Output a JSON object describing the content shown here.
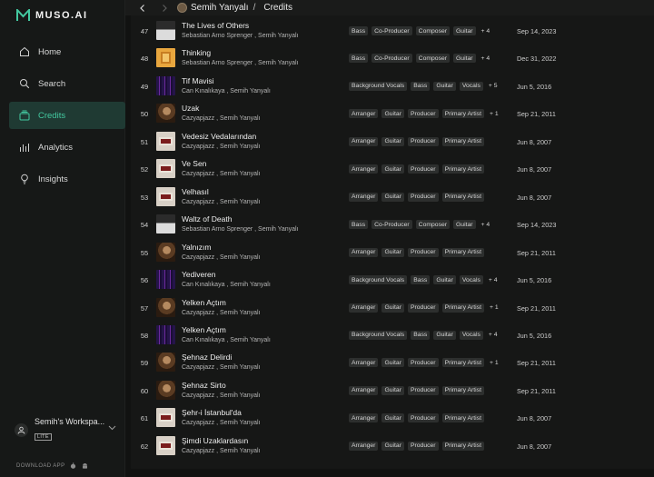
{
  "app": {
    "name": "MUSO.AI"
  },
  "nav": [
    {
      "label": "Home",
      "icon": "home-icon",
      "active": false
    },
    {
      "label": "Search",
      "icon": "search-icon",
      "active": false
    },
    {
      "label": "Credits",
      "icon": "credits-icon",
      "active": true
    },
    {
      "label": "Analytics",
      "icon": "analytics-icon",
      "active": false
    },
    {
      "label": "Insights",
      "icon": "lightbulb-icon",
      "active": false
    }
  ],
  "workspace": {
    "name": "Semih's Workspa...",
    "badge": "LITE"
  },
  "download": {
    "label": "DOWNLOAD APP"
  },
  "breadcrumb": {
    "artist": "Semih Yanyalı",
    "separator": "/",
    "page": "Credits"
  },
  "colors": {
    "accent": "#43c9a0",
    "active_bg": "#1f3a33",
    "tag_bg": "#2d2f2e"
  },
  "rows": [
    {
      "num": "47",
      "title": "The Lives of Others",
      "artists": "Sebastian Arno Sprenger , Semih Yanyalı",
      "tags": [
        "Bass",
        "Co-Producer",
        "Composer",
        "Guitar"
      ],
      "more": "+ 4",
      "date": "Sep 14, 2023",
      "art": "art-lives"
    },
    {
      "num": "48",
      "title": "Thinking",
      "artists": "Sebastian Arno Sprenger , Semih Yanyalı",
      "tags": [
        "Bass",
        "Co-Producer",
        "Composer",
        "Guitar"
      ],
      "more": "+ 4",
      "date": "Dec 31, 2022",
      "art": "art-thinking"
    },
    {
      "num": "49",
      "title": "Tif Mavisi",
      "artists": "Can Kınalıkaya , Semih Yanyalı",
      "tags": [
        "Background Vocals",
        "Bass",
        "Guitar",
        "Vocals"
      ],
      "more": "+ 5",
      "date": "Jun 5, 2016",
      "art": "art-tif"
    },
    {
      "num": "50",
      "title": "Uzak",
      "artists": "Cazyapjazz , Semih Yanyalı",
      "tags": [
        "Arranger",
        "Guitar",
        "Producer",
        "Primary Artist"
      ],
      "more": "+ 1",
      "date": "Sep 21, 2011",
      "art": "art-uzak"
    },
    {
      "num": "51",
      "title": "Vedesiz Vedalarından",
      "artists": "Cazyapjazz , Semih Yanyalı",
      "tags": [
        "Arranger",
        "Guitar",
        "Producer",
        "Primary Artist"
      ],
      "more": "",
      "date": "Jun 8, 2007",
      "art": "art-vedal"
    },
    {
      "num": "52",
      "title": "Ve Sen",
      "artists": "Cazyapjazz , Semih Yanyalı",
      "tags": [
        "Arranger",
        "Guitar",
        "Producer",
        "Primary Artist"
      ],
      "more": "",
      "date": "Jun 8, 2007",
      "art": "art-vedal"
    },
    {
      "num": "53",
      "title": "Velhasıl",
      "artists": "Cazyapjazz , Semih Yanyalı",
      "tags": [
        "Arranger",
        "Guitar",
        "Producer",
        "Primary Artist"
      ],
      "more": "",
      "date": "Jun 8, 2007",
      "art": "art-vedal"
    },
    {
      "num": "54",
      "title": "Waltz of Death",
      "artists": "Sebastian Arno Sprenger , Semih Yanyalı",
      "tags": [
        "Bass",
        "Co-Producer",
        "Composer",
        "Guitar"
      ],
      "more": "+ 4",
      "date": "Sep 14, 2023",
      "art": "art-lives"
    },
    {
      "num": "55",
      "title": "Yalnızım",
      "artists": "Cazyapjazz , Semih Yanyalı",
      "tags": [
        "Arranger",
        "Guitar",
        "Producer",
        "Primary Artist"
      ],
      "more": "",
      "date": "Sep 21, 2011",
      "art": "art-uzak"
    },
    {
      "num": "56",
      "title": "Yediveren",
      "artists": "Can Kınalıkaya , Semih Yanyalı",
      "tags": [
        "Background Vocals",
        "Bass",
        "Guitar",
        "Vocals"
      ],
      "more": "+ 4",
      "date": "Jun 5, 2016",
      "art": "art-tif"
    },
    {
      "num": "57",
      "title": "Yelken Açtım",
      "artists": "Cazyapjazz , Semih Yanyalı",
      "tags": [
        "Arranger",
        "Guitar",
        "Producer",
        "Primary Artist"
      ],
      "more": "+ 1",
      "date": "Sep 21, 2011",
      "art": "art-uzak"
    },
    {
      "num": "58",
      "title": "Yelken Açtım",
      "artists": "Can Kınalıkaya , Semih Yanyalı",
      "tags": [
        "Background Vocals",
        "Bass",
        "Guitar",
        "Vocals"
      ],
      "more": "+ 4",
      "date": "Jun 5, 2016",
      "art": "art-tif"
    },
    {
      "num": "59",
      "title": "Şehnaz Delirdi",
      "artists": "Cazyapjazz , Semih Yanyalı",
      "tags": [
        "Arranger",
        "Guitar",
        "Producer",
        "Primary Artist"
      ],
      "more": "+ 1",
      "date": "Sep 21, 2011",
      "art": "art-uzak"
    },
    {
      "num": "60",
      "title": "Şehnaz Sirto",
      "artists": "Cazyapjazz , Semih Yanyalı",
      "tags": [
        "Arranger",
        "Guitar",
        "Producer",
        "Primary Artist"
      ],
      "more": "",
      "date": "Sep 21, 2011",
      "art": "art-uzak"
    },
    {
      "num": "61",
      "title": "Şehr-i İstanbul'da",
      "artists": "Cazyapjazz , Semih Yanyalı",
      "tags": [
        "Arranger",
        "Guitar",
        "Producer",
        "Primary Artist"
      ],
      "more": "",
      "date": "Jun 8, 2007",
      "art": "art-vedal"
    },
    {
      "num": "62",
      "title": "Şimdi Uzaklardasın",
      "artists": "Cazyapjazz , Semih Yanyalı",
      "tags": [
        "Arranger",
        "Guitar",
        "Producer",
        "Primary Artist"
      ],
      "more": "",
      "date": "Jun 8, 2007",
      "art": "art-vedal"
    }
  ]
}
